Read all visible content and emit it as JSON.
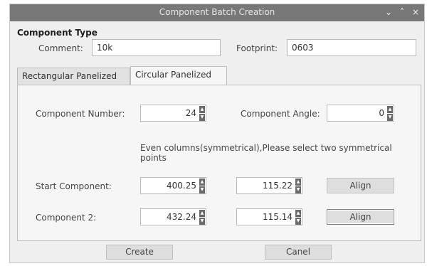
{
  "window": {
    "title": "Component Batch Creation",
    "controls": {
      "minimize": "⌄",
      "maximize": "˄",
      "close": "×"
    }
  },
  "component_type": {
    "heading": "Component Type",
    "comment_label": "Comment:",
    "comment_value": "10k",
    "footprint_label": "Footprint:",
    "footprint_value": "0603"
  },
  "tabs": [
    {
      "label": "Rectangular Panelized Board",
      "active": false
    },
    {
      "label": "Circular Panelized Board",
      "active": true
    }
  ],
  "circular": {
    "component_number_label": "Component Number:",
    "component_number_value": "24",
    "component_angle_label": "Component Angle:",
    "component_angle_value": "0",
    "hint": "Even columns(symmetrical),Please select two symmetrical points",
    "start_component_label": "Start Component:",
    "start_x": "400.25",
    "start_y": "115.22",
    "component2_label": "Component 2:",
    "comp2_x": "432.24",
    "comp2_y": "115.14",
    "align_label": "Align"
  },
  "footer": {
    "create_label": "Create",
    "cancel_label": "Canel"
  },
  "icons": {
    "spin_up": "▲",
    "spin_down": "▼"
  }
}
